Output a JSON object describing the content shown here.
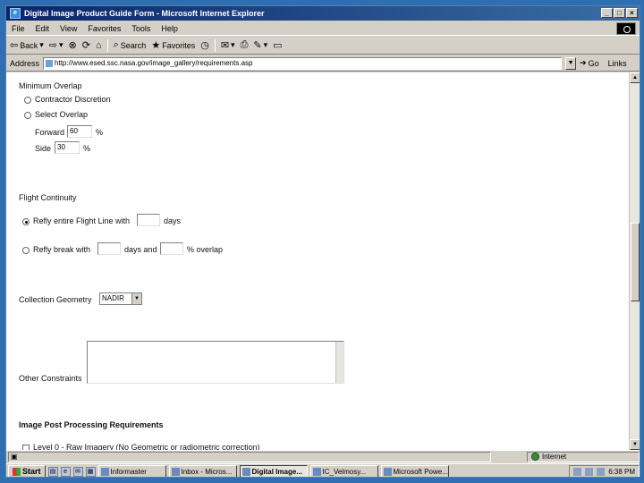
{
  "window": {
    "title": "Digital Image Product Guide Form - Microsoft Internet Explorer",
    "controls": [
      "_",
      "□",
      "×"
    ]
  },
  "menu": [
    "File",
    "Edit",
    "View",
    "Favorites",
    "Tools",
    "Help"
  ],
  "toolbar": {
    "back": "Back",
    "search": "Search",
    "favorites": "Favorites"
  },
  "address": {
    "label": "Address",
    "url": "http://www.esed.ssc.nasa.gov/image_gallery/requirements.asp",
    "go": "Go",
    "links": "Links"
  },
  "form": {
    "minimum_overlap": {
      "heading": "Minimum Overlap",
      "option_contractor": "Contractor Discretion",
      "option_select": "Select Overlap",
      "forward_label": "Forward",
      "forward_value": "60",
      "forward_unit": "%",
      "side_label": "Side",
      "side_value": "30",
      "side_unit": "%"
    },
    "flight_continuity": {
      "heading": "Flight Continuity",
      "option_entire": "Refly entire Flight Line with",
      "entire_unit": "days",
      "option_break_a": "Refly break with",
      "option_break_b": "days and",
      "option_break_c": "% overlap"
    },
    "collection_geometry": {
      "label": "Collection Geometry",
      "value": "NADIR"
    },
    "other_constraints": {
      "label": "Other Constraints"
    },
    "post_processing": {
      "heading": "Image Post Processing Requirements",
      "level0": "Level 0 - Raw Imagery (No Geometric or radiometric correction)"
    }
  },
  "status": {
    "zone": "Internet"
  },
  "taskbar": {
    "start": "Start",
    "tasks": [
      "Informaster",
      "Inbox - Micros...",
      "Digital Image...",
      "IC_Velmosy...",
      "Microsoft Powe..."
    ],
    "clock": "6:38 PM"
  }
}
